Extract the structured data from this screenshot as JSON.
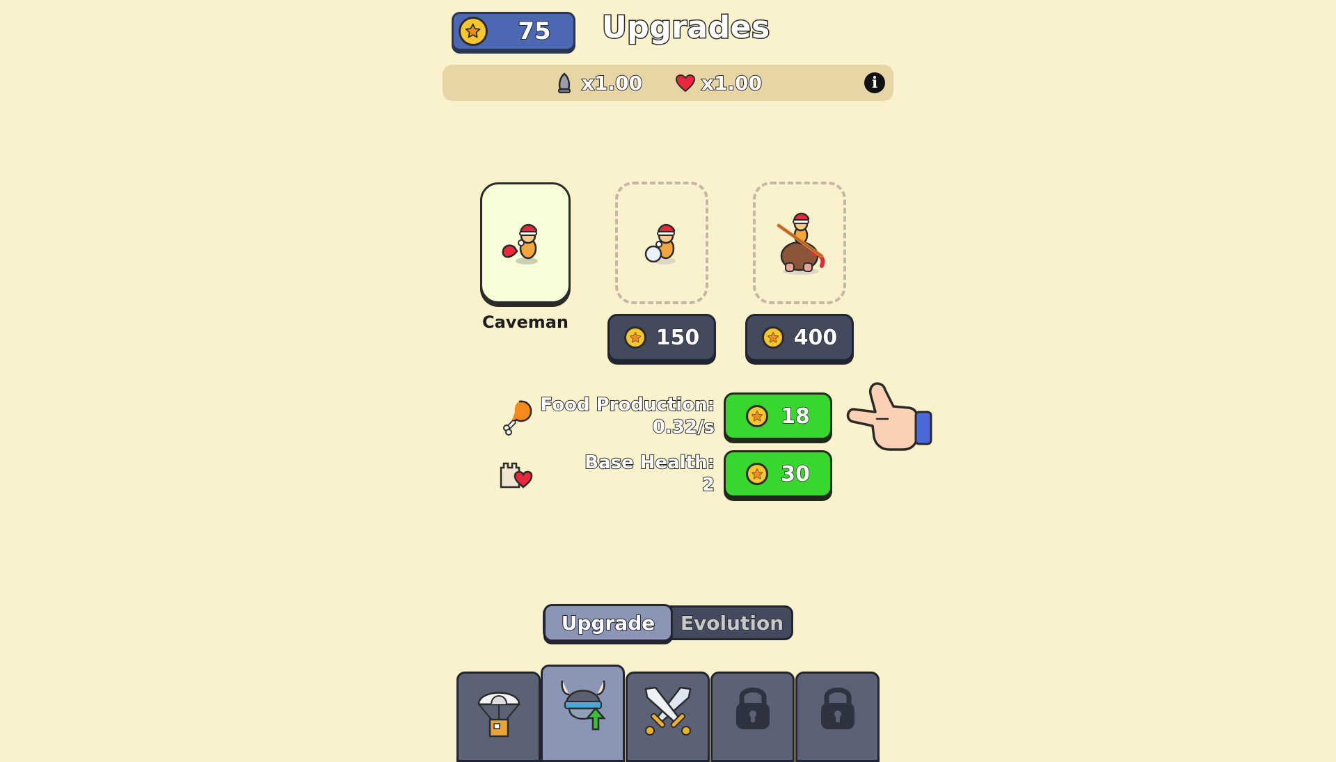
{
  "header": {
    "coins": "75",
    "title": "Upgrades"
  },
  "multipliers": {
    "attack": "x1.00",
    "health": "x1.00"
  },
  "units": {
    "current_name": "Caveman",
    "locked": [
      {
        "price": "150",
        "icon": "snowball-caveman"
      },
      {
        "price": "400",
        "icon": "mammoth-rider"
      }
    ]
  },
  "stats": [
    {
      "label_line1": "Food Production:",
      "label_line2": "0.32/s",
      "cost": "18",
      "icon": "drumstick-icon"
    },
    {
      "label_line1": "Base Health:",
      "label_line2": "2",
      "cost": "30",
      "icon": "base-health-icon"
    }
  ],
  "tabs": {
    "upgrade": "Upgrade",
    "evolution": "Evolution",
    "active": "Upgrade"
  },
  "nav": [
    {
      "icon": "parachute-crate-icon",
      "active": false
    },
    {
      "icon": "viking-upgrade-icon",
      "active": true
    },
    {
      "icon": "crossed-swords-icon",
      "active": false
    },
    {
      "icon": "lock-icon",
      "active": false
    },
    {
      "icon": "lock-icon",
      "active": false
    }
  ],
  "colors": {
    "background": "#faf2cd",
    "coin_box": "#4d68b3",
    "upgrade_green": "#39d62f",
    "dark_button": "#444a5d",
    "active_tab": "#8b96b7"
  }
}
